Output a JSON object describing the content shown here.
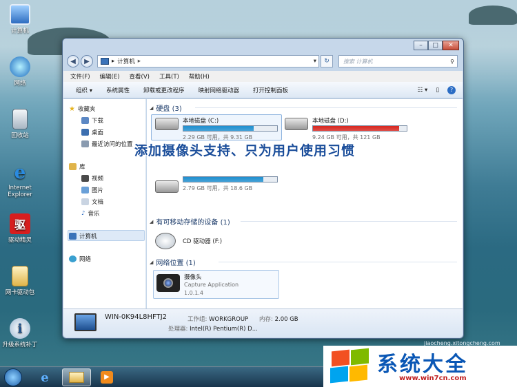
{
  "desktop": {
    "icons": [
      {
        "label": "计算机",
        "icon": "computer-icon"
      },
      {
        "label": "网络",
        "icon": "network-icon"
      },
      {
        "label": "回收站",
        "icon": "recycle-bin-icon"
      },
      {
        "label": "Internet Explorer",
        "icon": "ie-icon"
      },
      {
        "label": "驱动精灵",
        "icon": "driver-genius-icon"
      },
      {
        "label": "网卡驱动包",
        "icon": "folder-icon"
      },
      {
        "label": "升级系统补丁",
        "icon": "info-icon"
      }
    ]
  },
  "window": {
    "breadcrumb": "计算机",
    "search_placeholder": "搜索 计算机",
    "menu": [
      "文件(F)",
      "编辑(E)",
      "查看(V)",
      "工具(T)",
      "帮助(H)"
    ],
    "toolbar": [
      "组织 ▾",
      "系统属性",
      "卸载或更改程序",
      "映射网络驱动器",
      "打开控制面板"
    ]
  },
  "navpane": {
    "favorites": "收藏夹",
    "fav_items": [
      "下载",
      "桌面",
      "最近访问的位置"
    ],
    "library": "库",
    "lib_items": [
      "视频",
      "图片",
      "文档",
      "音乐"
    ],
    "computer": "计算机",
    "network": "网络"
  },
  "content": {
    "hdd_header": "硬盘 (3)",
    "drives": [
      {
        "name": "本地磁盘 (C:)",
        "info": "2.29 GB 可用，共 9.31 GB",
        "used": 0.75,
        "color": "#1e8fcf"
      },
      {
        "name": "本地磁盘 (D:)",
        "info": "9.24 GB 可用，共 121 GB",
        "used": 0.92,
        "color": "#d9261e"
      },
      {
        "name": "",
        "info": "2.79 GB 可用，共 18.6 GB",
        "used": 0.85,
        "color": "#1e8fcf"
      }
    ],
    "removable_header": "有可移动存储的设备 (1)",
    "cd_label": "CD 驱动器 (F:)",
    "network_header": "网络位置 (1)",
    "camera": {
      "name": "摄像头",
      "app": "Capture Application",
      "version": "1.0.1.4"
    }
  },
  "details": {
    "computer_name": "WIN-0K94L8HFTJ2",
    "workgroup_label": "工作组:",
    "workgroup": "WORKGROUP",
    "memory_label": "内存:",
    "memory": "2.00 GB",
    "cpu_label": "处理器:",
    "cpu": "Intel(R) Pentium(R) D..."
  },
  "overlay_text": "添加摄像头支持、只为用户使用习惯",
  "logo": {
    "title": "系统大全",
    "url": "www.win7cn.com"
  },
  "watermark": "jiaocheng.xitongcheng.com"
}
